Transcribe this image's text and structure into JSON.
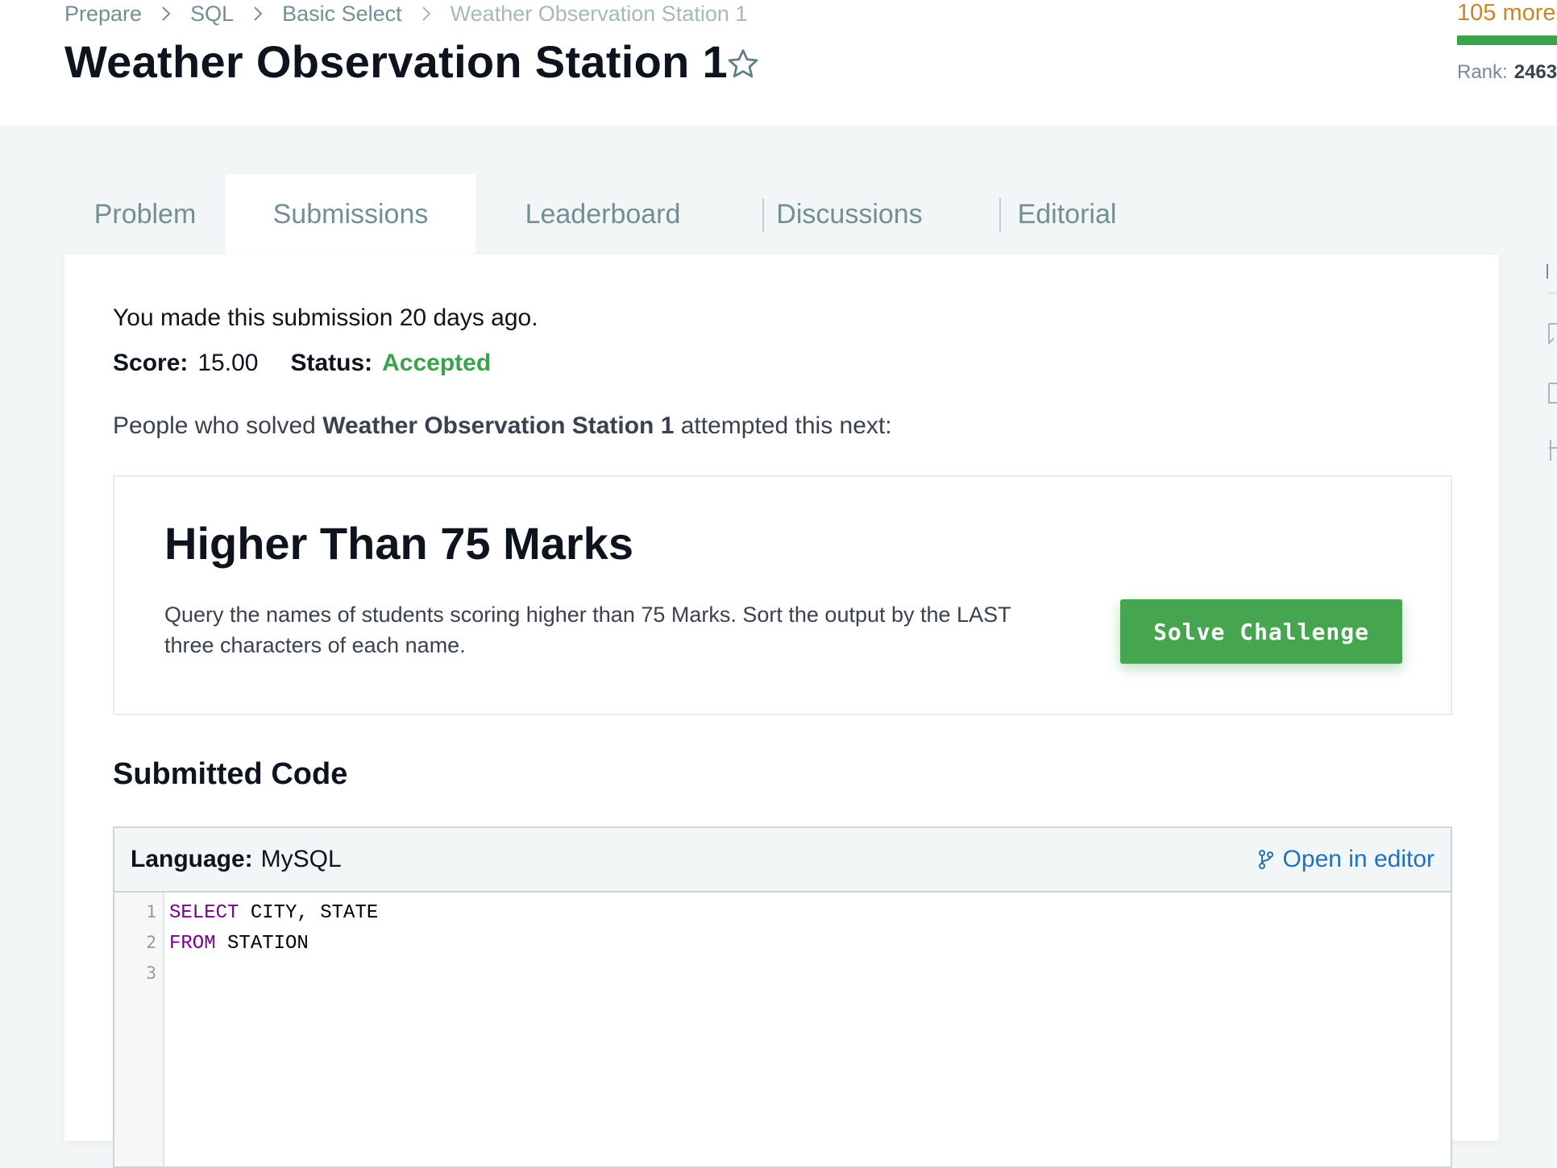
{
  "breadcrumb": [
    "Prepare",
    "SQL",
    "Basic Select",
    "Weather Observation Station 1"
  ],
  "title": "Weather Observation Station 1",
  "progress": {
    "more_text": "105 more",
    "rank_label": "Rank:",
    "rank_value": "2463"
  },
  "tabs": [
    "Problem",
    "Submissions",
    "Leaderboard",
    "Discussions",
    "Editorial"
  ],
  "active_tab": "Submissions",
  "submission": {
    "made_text": "You made this submission 20 days ago.",
    "score_label": "Score:",
    "score_value": "15.00",
    "status_label": "Status:",
    "status_value": "Accepted",
    "people_prefix": "People who solved",
    "people_challenge": "Weather Observation Station 1",
    "people_suffix": "attempted this next:"
  },
  "recommendation": {
    "title": "Higher Than 75 Marks",
    "description": "Query the names of students scoring higher than 75 Marks. Sort the output by the LAST three characters of each name.",
    "button": "Solve Challenge"
  },
  "code": {
    "section_title": "Submitted Code",
    "language_label": "Language:",
    "language_value": "MySQL",
    "open_editor": "Open in editor",
    "line_numbers": [
      "1",
      "2",
      "3"
    ],
    "lines": [
      {
        "keyword": "SELECT",
        "rest": " CITY, STATE"
      },
      {
        "keyword": "FROM",
        "rest": " STATION"
      },
      {
        "keyword": "",
        "rest": ""
      }
    ]
  },
  "colors": {
    "accent_green": "#39a34e",
    "link_blue": "#1f71c2",
    "progress_orange": "#c9862b"
  }
}
